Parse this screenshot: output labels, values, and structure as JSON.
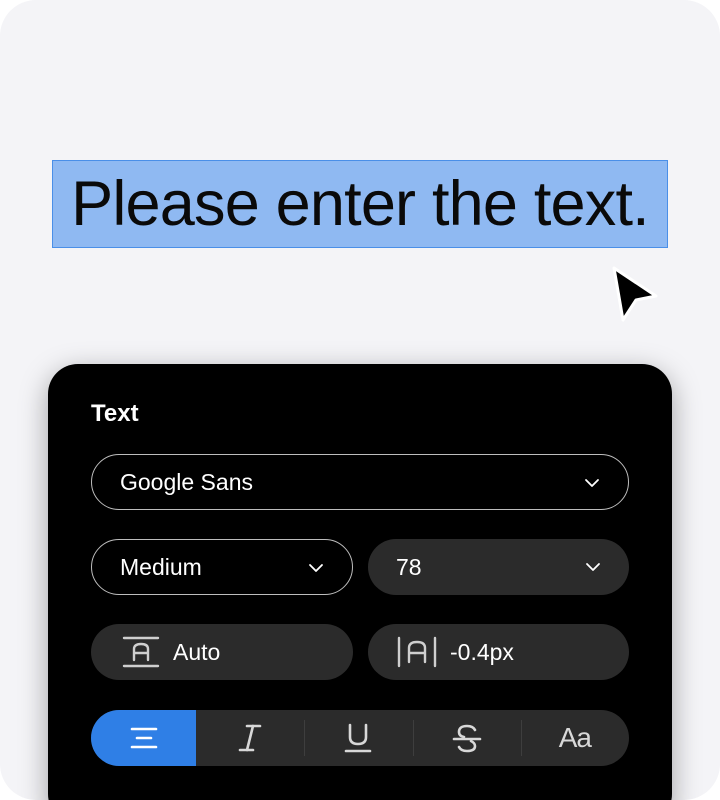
{
  "canvas": {
    "selected_text": "Please enter the text."
  },
  "panel": {
    "title": "Text",
    "font_family": "Google Sans",
    "font_weight": "Medium",
    "font_size": "78",
    "line_height": "Auto",
    "letter_spacing": "-0.4px",
    "style_buttons": [
      {
        "name": "align-center",
        "active": true
      },
      {
        "name": "italic",
        "active": false
      },
      {
        "name": "underline",
        "active": false
      },
      {
        "name": "strikethrough",
        "active": false
      },
      {
        "name": "text-case",
        "active": false,
        "glyph": "Aa"
      }
    ]
  },
  "colors": {
    "selection_fill": "#8fb9f2",
    "selection_border": "#4a8fe8",
    "accent": "#2f7fe6",
    "panel_bg": "#000000",
    "field_bg": "#2b2b2b"
  }
}
